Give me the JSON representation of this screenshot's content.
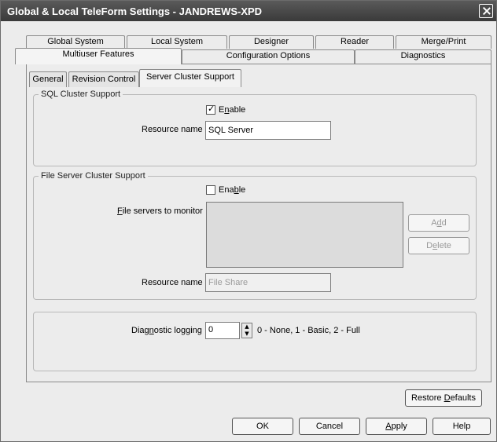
{
  "window": {
    "title": "Global & Local TeleForm Settings - JANDREWS-XPD"
  },
  "tabs_row1": [
    "Global System",
    "Local System",
    "Designer",
    "Reader",
    "Merge/Print"
  ],
  "tabs_row2": [
    "Multiuser Features",
    "Configuration Options",
    "Diagnostics"
  ],
  "subtabs": [
    "General",
    "Revision Control",
    "Server Cluster Support"
  ],
  "sql_group": {
    "legend": "SQL Cluster Support",
    "enable_label_pre": "E",
    "enable_label_acc": "n",
    "enable_label_post": "able",
    "enable_checked": true,
    "resource_label": "Resource name",
    "resource_value": "SQL Server"
  },
  "file_group": {
    "legend": "File Server Cluster Support",
    "enable_label_pre": "Ena",
    "enable_label_acc": "b",
    "enable_label_post": "le",
    "enable_checked": false,
    "monitor_label_acc": "F",
    "monitor_label_post": "ile servers to monitor",
    "add_pre": "A",
    "add_acc": "d",
    "add_post": "d",
    "delete_pre": "D",
    "delete_acc": "e",
    "delete_post": "lete",
    "resource_label": "Resource name",
    "resource_value": "File Share"
  },
  "diag_group": {
    "label_pre": "Diag",
    "label_acc": "n",
    "label_post": "ostic logging",
    "value": "0",
    "hint": "0 - None, 1 - Basic, 2 - Full"
  },
  "restore_pre": "Restore ",
  "restore_acc": "D",
  "restore_post": "efaults",
  "footer": {
    "ok": "OK",
    "cancel": "Cancel",
    "apply_acc": "A",
    "apply_post": "pply",
    "help": "Help"
  }
}
